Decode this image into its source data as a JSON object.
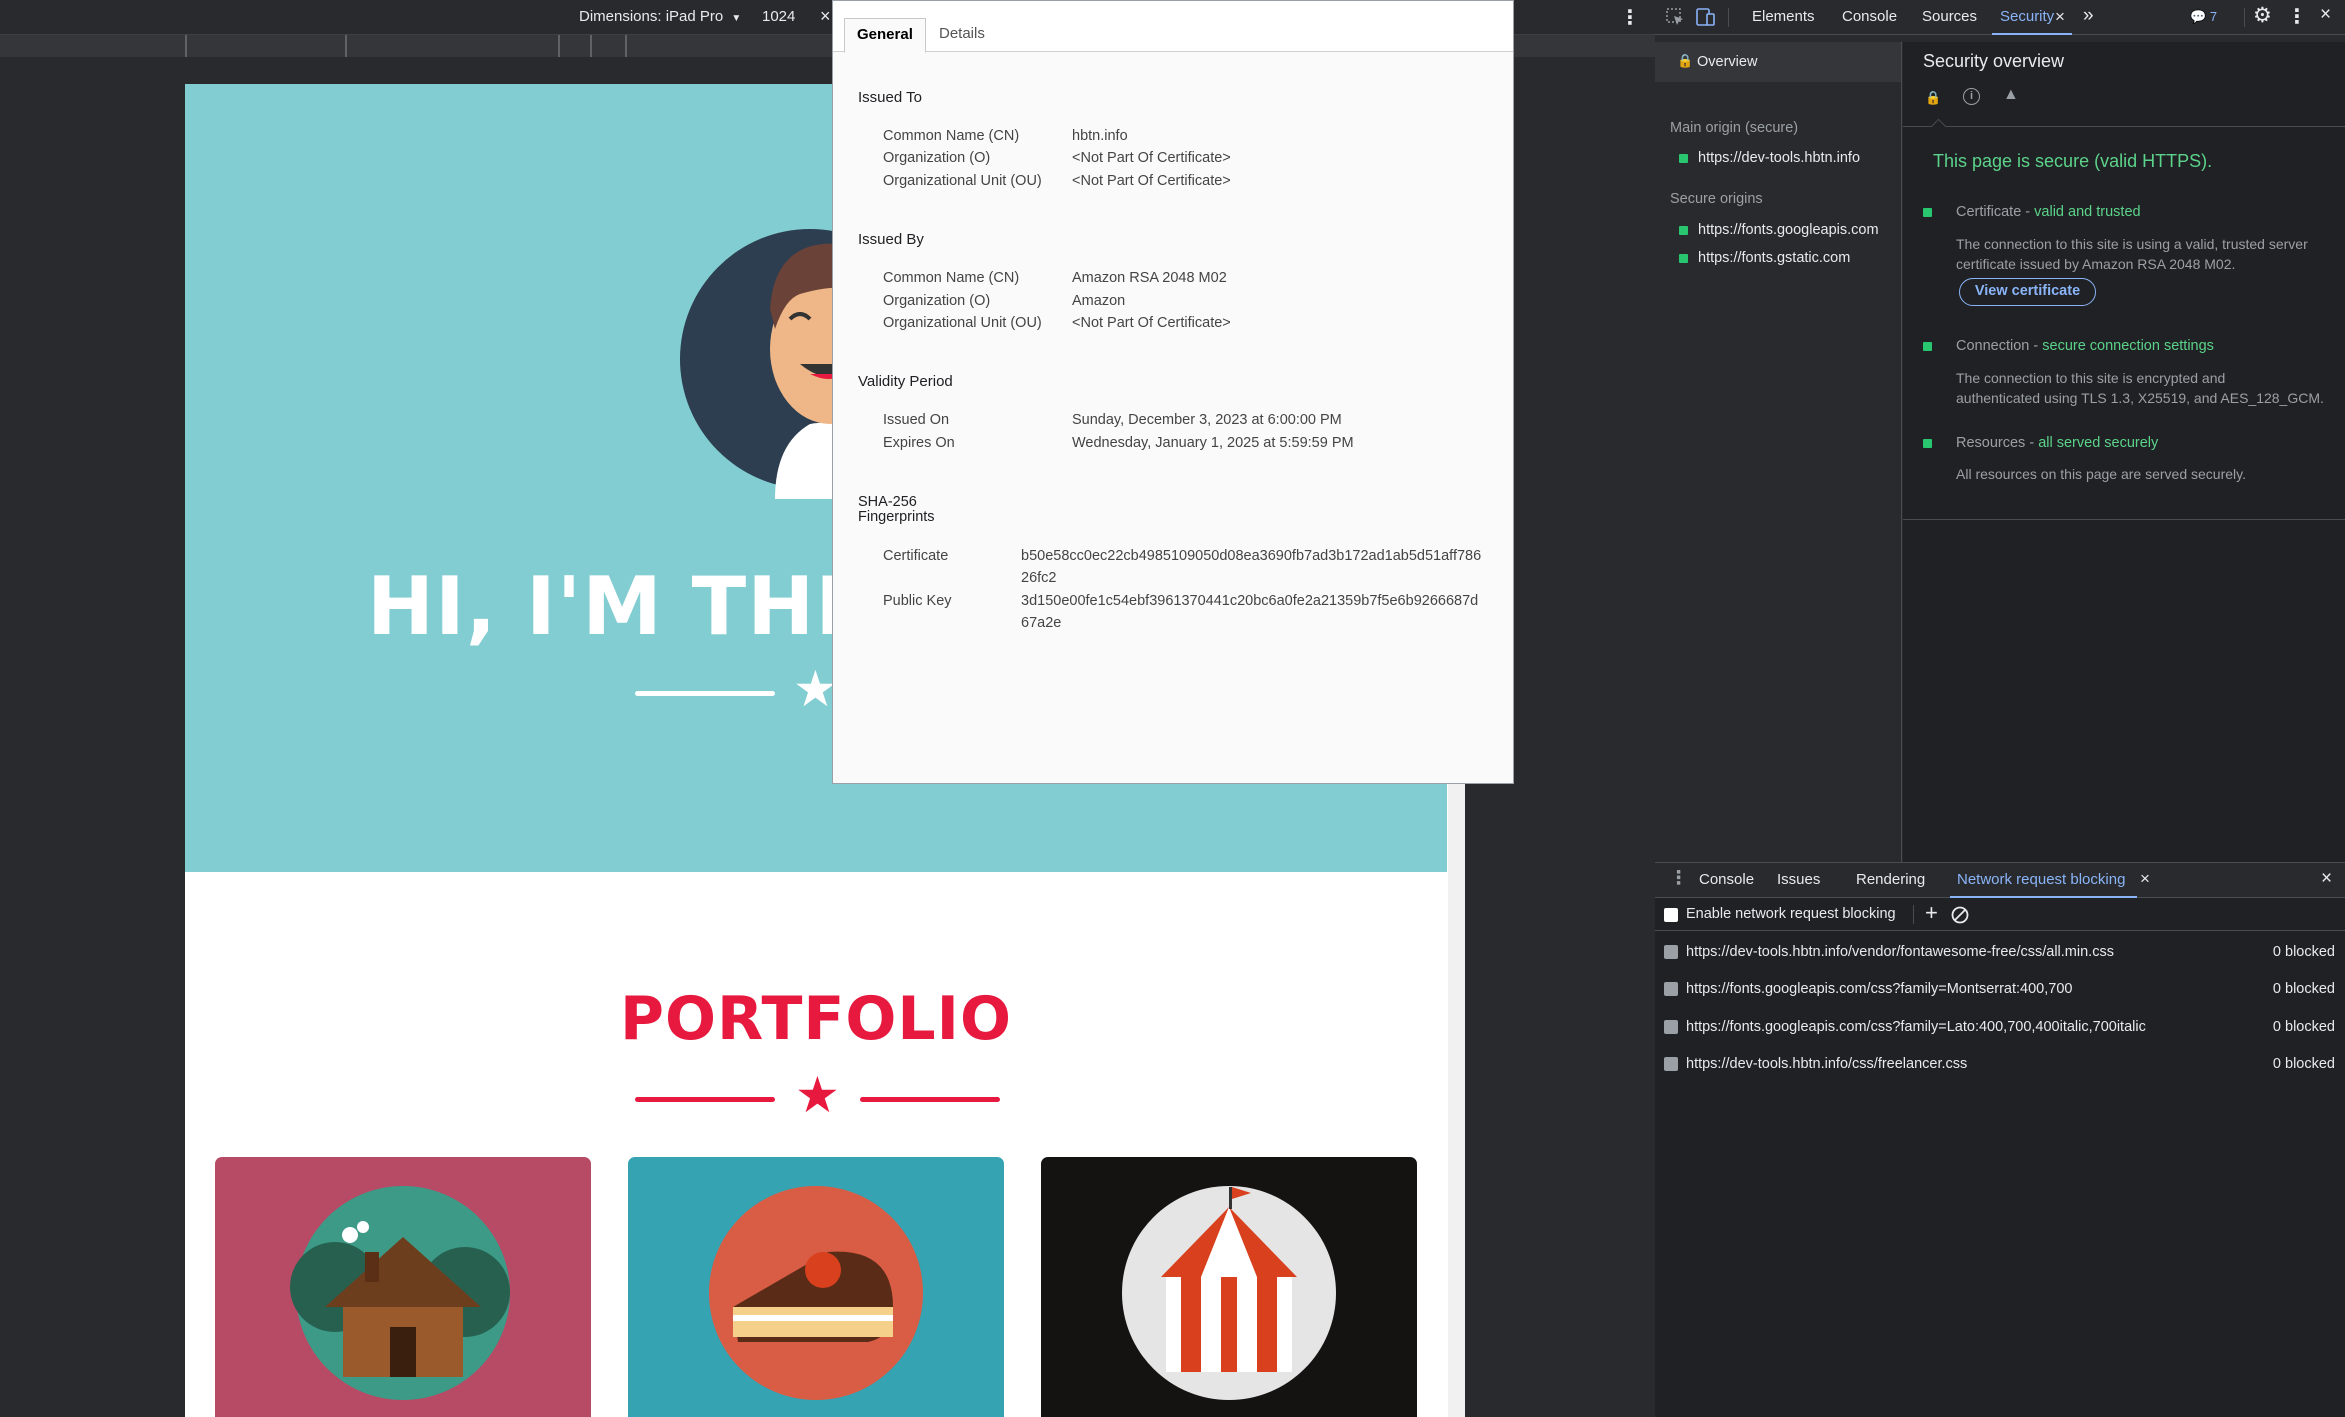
{
  "device_toolbar": {
    "dimensions_label": "Dimensions: iPad Pro",
    "width_value": "1024",
    "close_glyph": "×",
    "more_glyph": "⋮"
  },
  "page": {
    "hero_title": "HI, I'M THE",
    "portfolio_title": "PORTFOLIO",
    "colors": {
      "hero_bg": "#82cdd1",
      "accent": "#e8193f",
      "card1": "#b74b65",
      "card2": "#35a3b2",
      "card3": "#151212"
    }
  },
  "certificate": {
    "tabs": [
      "General",
      "Details"
    ],
    "issued_to": {
      "heading": "Issued To",
      "rows": [
        {
          "label": "Common Name (CN)",
          "value": "hbtn.info"
        },
        {
          "label": "Organization (O)",
          "value": "<Not Part Of Certificate>"
        },
        {
          "label": "Organizational Unit (OU)",
          "value": "<Not Part Of Certificate>"
        }
      ]
    },
    "issued_by": {
      "heading": "Issued By",
      "rows": [
        {
          "label": "Common Name (CN)",
          "value": "Amazon RSA 2048 M02"
        },
        {
          "label": "Organization (O)",
          "value": "Amazon"
        },
        {
          "label": "Organizational Unit (OU)",
          "value": "<Not Part Of Certificate>"
        }
      ]
    },
    "validity": {
      "heading": "Validity Period",
      "rows": [
        {
          "label": "Issued On",
          "value": "Sunday, December 3, 2023 at 6:00:00 PM"
        },
        {
          "label": "Expires On",
          "value": "Wednesday, January 1, 2025 at 5:59:59 PM"
        }
      ]
    },
    "fingerprints": {
      "heading_line1": "SHA-256",
      "heading_line2": "Fingerprints",
      "certificate_label": "Certificate",
      "certificate_line1": "b50e58cc0ec22cb4985109050d08ea3690fb7ad3b172ad1ab5d51aff786",
      "certificate_line2": "26fc2",
      "public_key_label": "Public Key",
      "public_key_line1": "3d150e00fe1c54ebf3961370441c20bc6a0fe2a21359b7f5e6b9266687d",
      "public_key_line2": "67a2e"
    }
  },
  "devtools": {
    "tabs": [
      "Elements",
      "Console",
      "Sources",
      "Security"
    ],
    "active_tab": "Security",
    "more_tabs_glyph": "»",
    "issues_count": "7",
    "sidebar": {
      "overview_label": "Overview",
      "main_origin_heading": "Main origin (secure)",
      "main_origin": "https://dev-tools.hbtn.info",
      "secure_origins_heading": "Secure origins",
      "secure_origins": [
        "https://fonts.googleapis.com",
        "https://fonts.gstatic.com"
      ]
    },
    "overview": {
      "title": "Security overview",
      "summary": "This page is secure (valid HTTPS).",
      "certificate_label": "Certificate - ",
      "certificate_status": "valid and trusted",
      "certificate_desc_line1": "The connection to this site is using a valid, trusted server",
      "certificate_desc_line2": "certificate issued by Amazon RSA 2048 M02.",
      "view_certificate_button": "View certificate",
      "connection_label": "Connection - ",
      "connection_status": "secure connection settings",
      "connection_desc_line1": "The connection to this site is encrypted and",
      "connection_desc_line2": "authenticated using TLS 1.3, X25519, and AES_128_GCM.",
      "resources_label": "Resources - ",
      "resources_status": "all served securely",
      "resources_desc": "All resources on this page are served securely.",
      "colors": {
        "secure_green": "#5bd38a",
        "active_tab": "#8ab4f8"
      }
    },
    "drawer": {
      "tabs": [
        "Console",
        "Issues",
        "Rendering",
        "Network request blocking"
      ],
      "active_tab": "Network request blocking",
      "enable_label": "Enable network request blocking",
      "patterns": [
        {
          "url": "https://dev-tools.hbtn.info/vendor/fontawesome-free/css/all.min.css",
          "status": "0 blocked"
        },
        {
          "url": "https://fonts.googleapis.com/css?family=Montserrat:400,700",
          "status": "0 blocked"
        },
        {
          "url": "https://fonts.googleapis.com/css?family=Lato:400,700,400italic,700italic",
          "status": "0 blocked"
        },
        {
          "url": "https://dev-tools.hbtn.info/css/freelancer.css",
          "status": "0 blocked"
        }
      ]
    }
  }
}
